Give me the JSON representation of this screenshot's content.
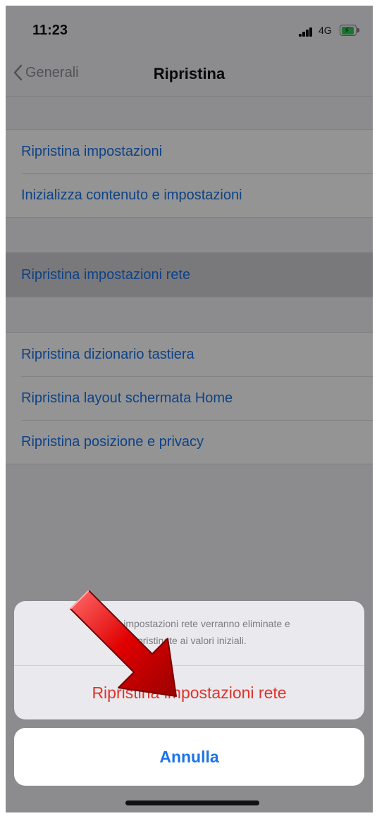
{
  "status_bar": {
    "time": "11:23",
    "network": "4G",
    "battery_color": "#34c759",
    "battery_icon": "charging-battery-icon"
  },
  "nav": {
    "back_label": "Generali",
    "title": "Ripristina"
  },
  "groups": [
    {
      "items": [
        "Ripristina impostazioni",
        "Inizializza contenuto e impostazioni"
      ]
    },
    {
      "items": [
        "Ripristina impostazioni rete"
      ]
    },
    {
      "items": [
        "Ripristina dizionario tastiera",
        "Ripristina layout schermata Home",
        "Ripristina posizione e privacy"
      ]
    }
  ],
  "action_sheet": {
    "message_line1": "Tutte le impostazioni rete verranno eliminate e",
    "message_line2": "ripristinate ai valori iniziali.",
    "action_label": "Ripristina impostazioni rete",
    "cancel_label": "Annulla"
  },
  "colors": {
    "link_blue": "#1a73e8",
    "destructive_red": "#e0342a",
    "arrow_red": "#d40000"
  }
}
